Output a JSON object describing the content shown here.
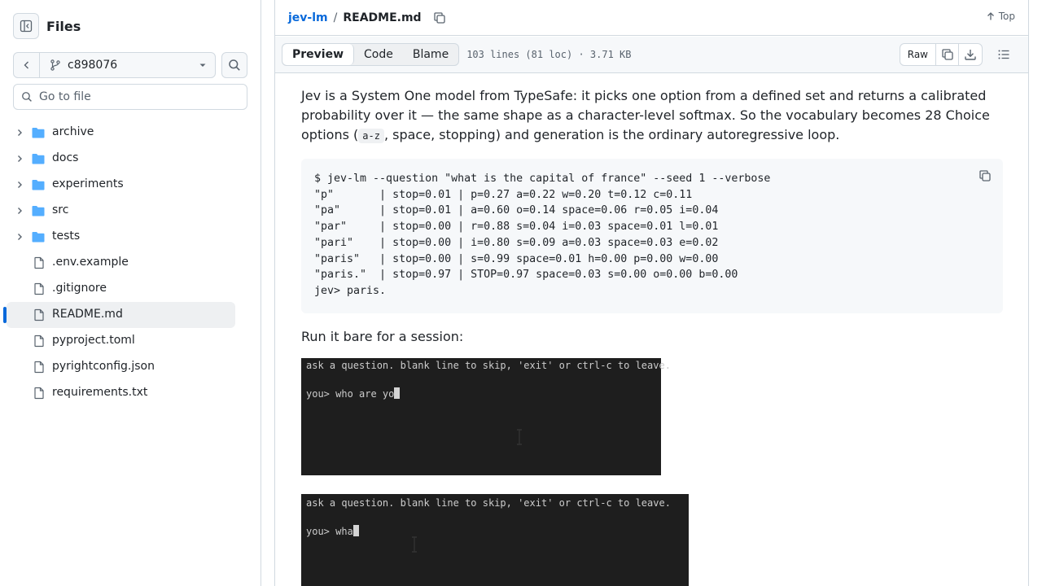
{
  "sidebar": {
    "title": "Files",
    "branch": "c898076",
    "goto_placeholder": "Go to file",
    "tree": [
      {
        "type": "folder",
        "label": "archive"
      },
      {
        "type": "folder",
        "label": "docs"
      },
      {
        "type": "folder",
        "label": "experiments"
      },
      {
        "type": "folder",
        "label": "src"
      },
      {
        "type": "folder",
        "label": "tests"
      },
      {
        "type": "file",
        "label": ".env.example"
      },
      {
        "type": "file",
        "label": ".gitignore"
      },
      {
        "type": "file",
        "label": "README.md",
        "selected": true
      },
      {
        "type": "file",
        "label": "pyproject.toml"
      },
      {
        "type": "file",
        "label": "pyrightconfig.json"
      },
      {
        "type": "file",
        "label": "requirements.txt"
      }
    ]
  },
  "header": {
    "repo": "jev-lm",
    "separator": "/",
    "file": "README.md",
    "top_label": "Top"
  },
  "toolbar": {
    "tabs": [
      "Preview",
      "Code",
      "Blame"
    ],
    "active_tab": "Preview",
    "file_info": "103 lines (81 loc) · 3.71 KB",
    "raw_label": "Raw"
  },
  "readme": {
    "para1_before_code": "Jev is a System One model from TypeSafe: it picks one option from a defined set and returns a calibrated probability over it — the same shape as a character-level softmax. So the vocabulary becomes 28 Choice options (",
    "para1_code": "a-z",
    "para1_after_code": ", space, stopping) and generation is the ordinary autoregressive loop.",
    "code_lines": [
      "$ jev-lm --question \"what is the capital of france\" --seed 1 --verbose",
      "\"p\"       | stop=0.01 | p=0.27 a=0.22 w=0.20 t=0.12 c=0.11",
      "\"pa\"      | stop=0.01 | a=0.60 o=0.14 space=0.06 r=0.05 i=0.04",
      "\"par\"     | stop=0.00 | r=0.88 s=0.04 i=0.03 space=0.01 l=0.01",
      "\"pari\"    | stop=0.00 | i=0.80 s=0.09 a=0.03 space=0.03 e=0.02",
      "\"paris\"   | stop=0.00 | s=0.99 space=0.01 h=0.00 p=0.00 w=0.00",
      "\"paris.\"  | stop=0.97 | STOP=0.97 space=0.03 s=0.00 o=0.00 b=0.00",
      "jev> paris."
    ],
    "para2": "Run it bare for a session:",
    "term1": {
      "line1": "ask a question. blank line to skip, 'exit' or ctrl-c to leave.",
      "line2": "you> who are yo"
    },
    "term2": {
      "line1": "ask a question. blank line to skip, 'exit' or ctrl-c to leave.",
      "line2": "you> wha"
    }
  }
}
